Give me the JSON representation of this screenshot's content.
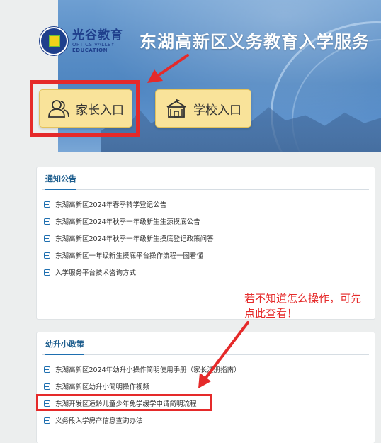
{
  "header": {
    "logo_cn": "光谷教育",
    "logo_en_1": "OPTICS VALLEY",
    "logo_en_2": "EDUCATION",
    "title": "东湖高新区义务教育入学服务"
  },
  "entries": {
    "parent_label": "家长入口",
    "school_label": "学校入口"
  },
  "notice": {
    "heading": "通知公告",
    "items": [
      "东湖高新区2024年春季转学登记公告",
      "东湖高新区2024年秋季一年级新生生源摸底公告",
      "东湖高新区2024年秋季一年级新生摸底登记政策问答",
      "东湖高新区一年级新生摸底平台操作流程一图看懂",
      "入学服务平台技术咨询方式"
    ]
  },
  "policy": {
    "heading": "幼升小政策",
    "items": [
      "东湖高新区2024年幼升小操作简明使用手册（家长注册指南）",
      "东湖高新区幼升小简明操作视频",
      "东湖开发区适龄儿童少年免学缓学申请简明流程",
      "义务段入学房产信息查询办法"
    ]
  },
  "annotation": {
    "line1": "若不知道怎么操作，可先",
    "line2": "点此查看！"
  },
  "colors": {
    "accent": "#1e6fb0",
    "annotation_red": "#e52a2a",
    "entry_yellow": "#f9e39a"
  }
}
